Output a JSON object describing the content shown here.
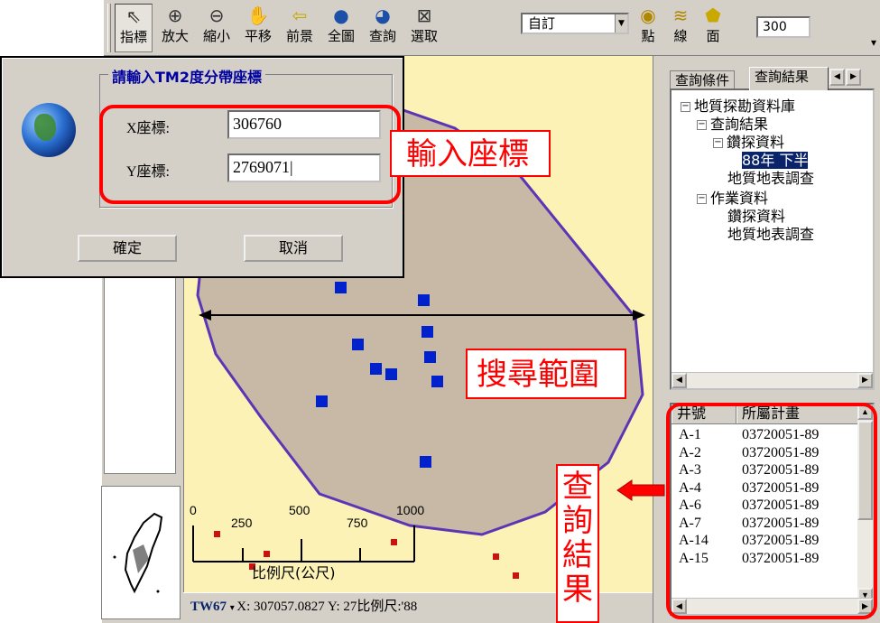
{
  "toolbar": {
    "tools": [
      {
        "label": "指標",
        "icon": "pointer-arrow-icon"
      },
      {
        "label": "放大",
        "icon": "zoom-in-icon"
      },
      {
        "label": "縮小",
        "icon": "zoom-out-icon"
      },
      {
        "label": "平移",
        "icon": "pan-hand-icon"
      },
      {
        "label": "前景",
        "icon": "previous-view-icon"
      },
      {
        "label": "全圖",
        "icon": "full-extent-globe-icon"
      },
      {
        "label": "查詢",
        "icon": "query-globe-icon"
      },
      {
        "label": "選取",
        "icon": "select-icon"
      }
    ],
    "combo_value": "自訂",
    "shape_tools": [
      {
        "label": "點",
        "icon": "point-icon"
      },
      {
        "label": "線",
        "icon": "line-icon"
      },
      {
        "label": "面",
        "icon": "polygon-icon"
      }
    ],
    "scale_value": "300"
  },
  "dialog": {
    "title": "請輸入TM2度分帶座標",
    "x_label": "X座標:",
    "x_value": "306760",
    "y_label": "Y座標:",
    "y_value": "2769071",
    "ok_label": "確定",
    "cancel_label": "取消"
  },
  "map": {
    "scale_ticks": [
      "0",
      "250",
      "500",
      "750",
      "1000"
    ],
    "scale_label": "比例尺(公尺)"
  },
  "status": {
    "crs": "TW67",
    "text": "X: 307057.0827 Y: 27比例尺:'88"
  },
  "right_panel": {
    "tabs": [
      "查詢條件",
      "查詢結果"
    ],
    "tree": [
      {
        "label": "地質探勘資料庫",
        "box": "−"
      },
      {
        "label": "查詢結果",
        "box": "−"
      },
      {
        "label": "鑽探資料",
        "box": "−"
      },
      {
        "label": "88年 下半"
      },
      {
        "label": "地質地表調查"
      },
      {
        "label": "作業資料",
        "box": "−"
      },
      {
        "label": "鑽探資料"
      },
      {
        "label": "地質地表調查"
      }
    ],
    "list_headers": [
      "井號",
      "所屬計畫"
    ],
    "list_rows": [
      {
        "well": "A-1",
        "plan": "03720051-89"
      },
      {
        "well": "A-2",
        "plan": "03720051-89"
      },
      {
        "well": "A-3",
        "plan": "03720051-89"
      },
      {
        "well": "A-4",
        "plan": "03720051-89"
      },
      {
        "well": "A-6",
        "plan": "03720051-89"
      },
      {
        "well": "A-7",
        "plan": "03720051-89"
      },
      {
        "well": "A-14",
        "plan": "03720051-89"
      },
      {
        "well": "A-15",
        "plan": "03720051-89"
      }
    ]
  },
  "annotations": {
    "input_coords": "輸入座標",
    "search_range": "搜尋範圍",
    "query_results": "查詢結果"
  },
  "colors": {
    "map_bg": "#fdf2b6",
    "search_area_fill": "#c8b9a6",
    "search_area_stroke": "#5b35b5",
    "point_blue": "#0022cc",
    "point_red": "#cc1111",
    "annotation_red": "#ff0000"
  }
}
